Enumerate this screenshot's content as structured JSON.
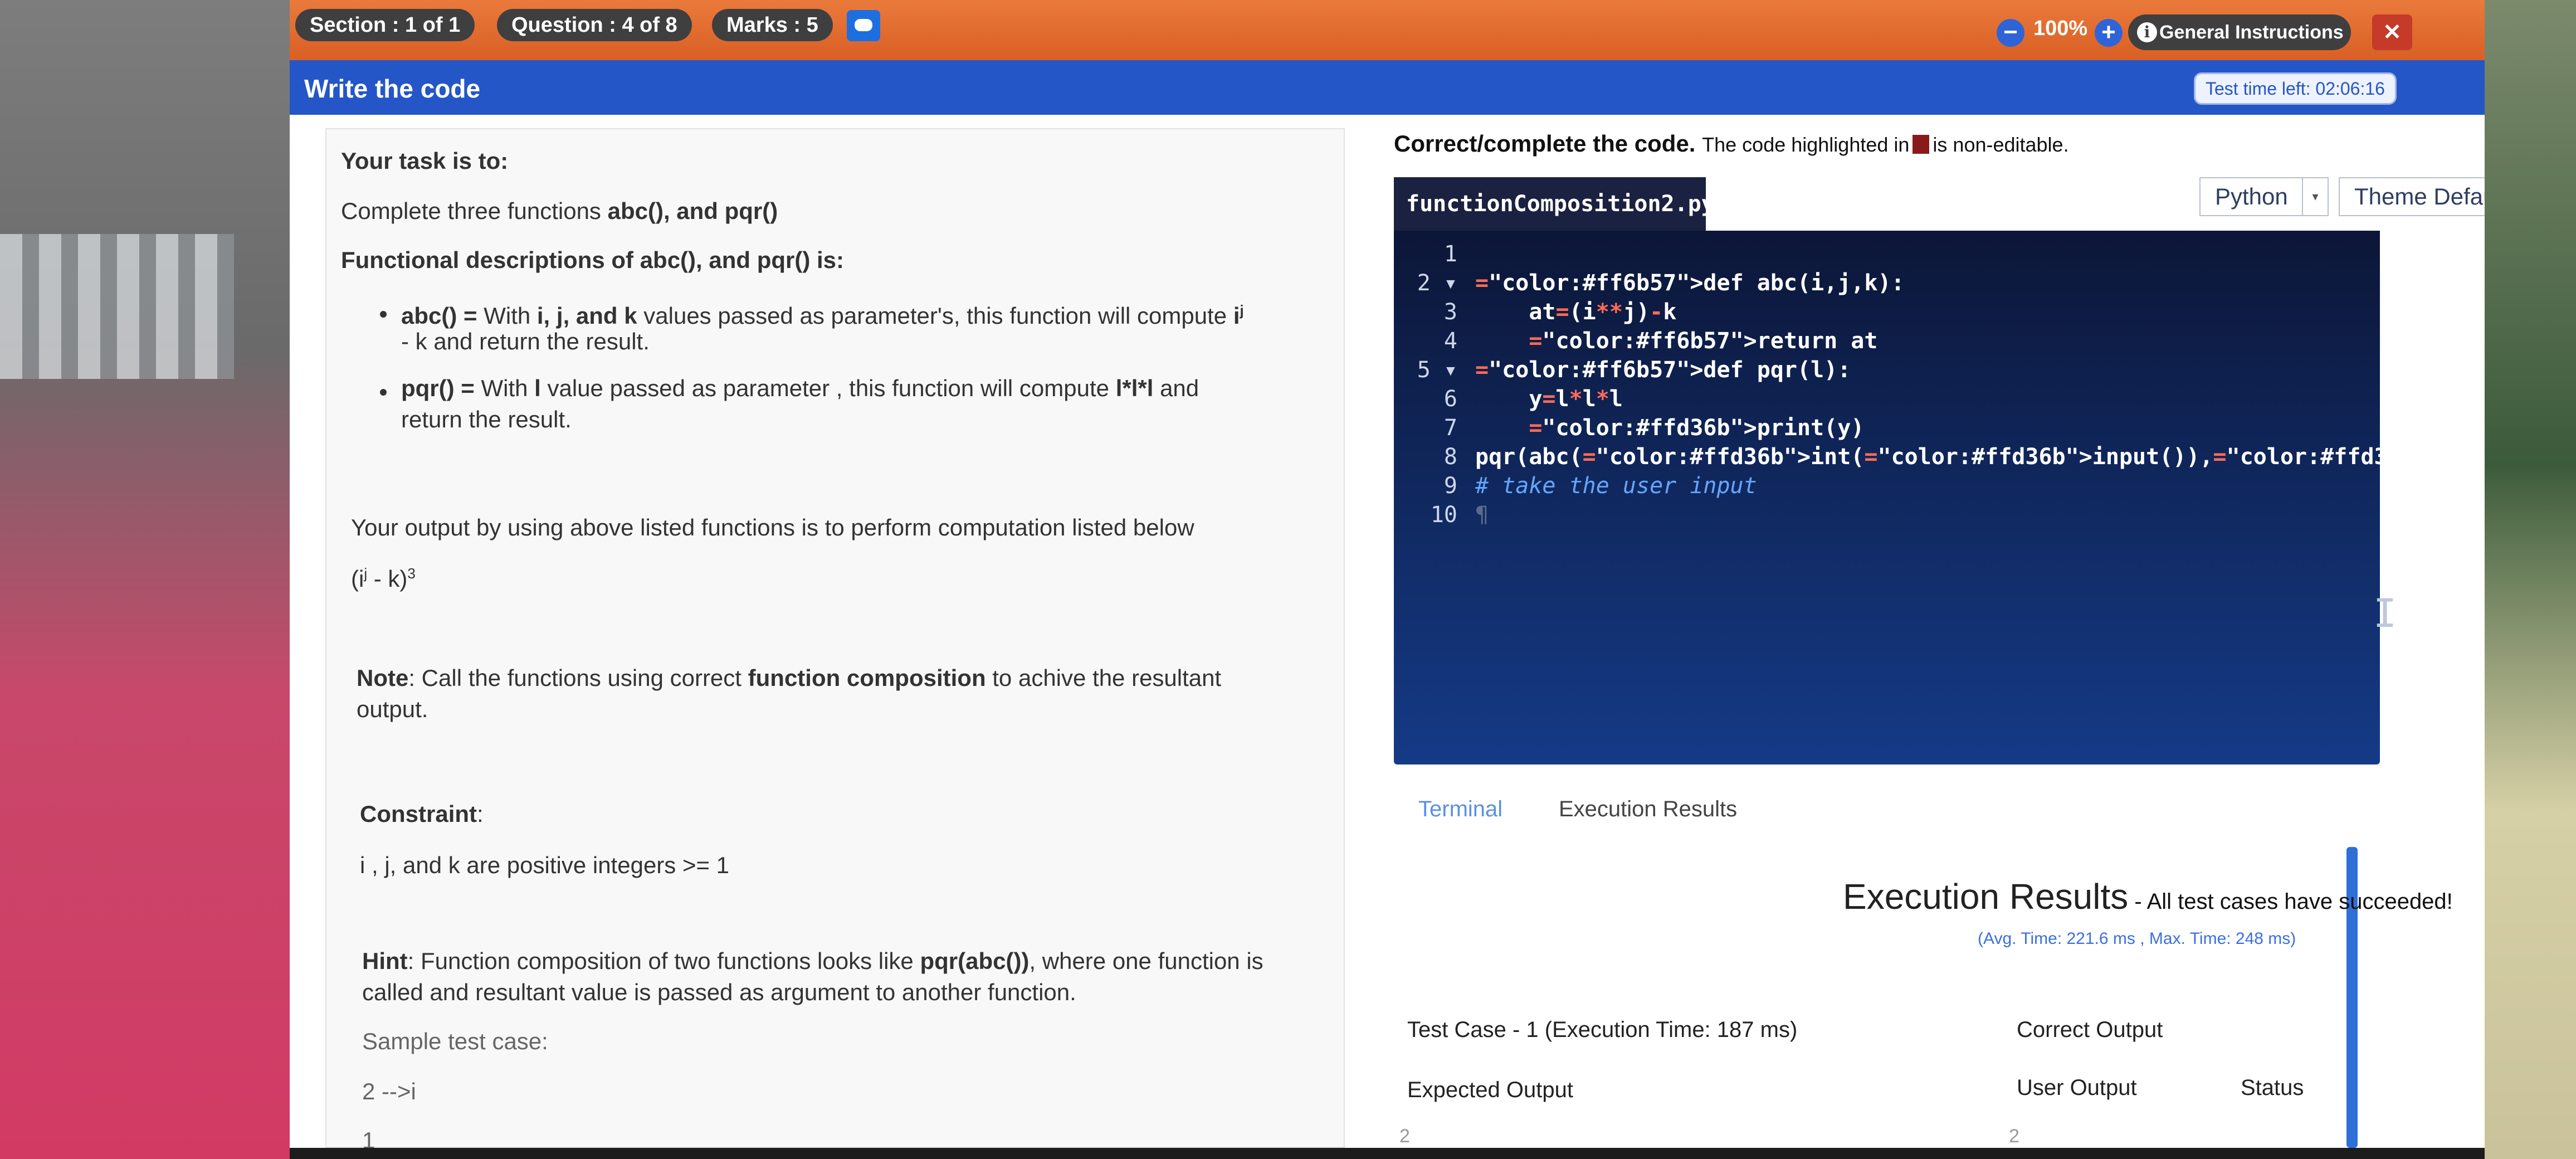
{
  "header": {
    "section": "Section : 1 of 1",
    "question": "Question : 4 of 8",
    "marks": "Marks : 5",
    "zoom_minus": "−",
    "zoom": "100%",
    "zoom_plus": "+",
    "general_instructions": "General Instructions",
    "info_glyph": "i",
    "close": "✕"
  },
  "subheader": {
    "title": "Write the code",
    "timer": "Test time left: 02:06:16"
  },
  "task": {
    "heading": "Your task is to:",
    "intro_prefix": "Complete three functions ",
    "intro_bold": "abc(), and pqr()",
    "desc_heading": "Functional descriptions of abc(), and pqr() is:",
    "b1_name": "abc() =",
    "b1_t1": " With ",
    "b1_bold": "i, j, and k",
    "b1_t2": " values passed as parameter's, this function will compute ",
    "b1_i": "i",
    "b1_sup": "j",
    "b1_line2": "- k and return the result.",
    "b2_name": "pqr() =",
    "b2_t1": " With ",
    "b2_bold1": "l",
    "b2_t2": " value passed as parameter , this function will compute ",
    "b2_bold2": "l*l*l",
    "b2_t3": " and",
    "b2_line2": "return the result.",
    "output_text": "Your output by using above listed functions is to perform computation listed below",
    "formula_open": "(i",
    "formula_sup": "j",
    "formula_mid": " - k)",
    "formula_pow": "3",
    "note_label": "Note",
    "note_t1": ": Call the functions using correct ",
    "note_bold": "function composition",
    "note_t2": " to achive the resultant",
    "note_line2": "output.",
    "constraint_label": "Constraint",
    "constraint_label_tail": ":",
    "constraint_text": "i , j, and k are positive integers >= 1",
    "hint_label": "Hint",
    "hint_t1": ": Function composition of two functions looks like ",
    "hint_bold": "pqr(abc())",
    "hint_t2": ", where one function is",
    "hint_line2": "called and resultant value is passed as argument to another function.",
    "sample_label": "Sample test case:",
    "sample_line1": "2 -->i",
    "sample_line2": "1"
  },
  "editor": {
    "heading": "Correct/complete the code.",
    "note_before": "The code highlighted in",
    "note_after": "is non-editable.",
    "noneditable_color": "#8a1a1a",
    "file_tab": "functionComposition2.py",
    "language": "Python",
    "theme": "Theme Default",
    "theme_clear": "×",
    "dropdown_arrow": "▾",
    "cursor_glyph": "I",
    "lines": [
      {
        "n": "1",
        "mark": "",
        "text": ""
      },
      {
        "n": "2",
        "mark": "▾",
        "text": "def abc(i,j,k):"
      },
      {
        "n": "3",
        "mark": "",
        "text": "    at=(i**j)-k"
      },
      {
        "n": "4",
        "mark": "",
        "text": "    return at"
      },
      {
        "n": "5",
        "mark": "▾",
        "text": "def pqr(l):"
      },
      {
        "n": "6",
        "mark": "",
        "text": "    y=l*l*l"
      },
      {
        "n": "7",
        "mark": "",
        "text": "    print(y)"
      },
      {
        "n": "8",
        "mark": "",
        "text": "pqr(abc(int(input()),int(input()),int(input())))"
      },
      {
        "n": "9",
        "mark": "",
        "text": "# take the user input"
      },
      {
        "n": "10",
        "mark": "",
        "text": "¶"
      }
    ]
  },
  "results": {
    "tab_terminal": "Terminal",
    "tab_results": "Execution Results",
    "title": "Execution Results",
    "status": " - All test cases have succeeded!",
    "avg": "(Avg. Time: 221.6 ms , Max. Time: 248 ms)",
    "testcase": "Test Case - 1",
    "exec_time": "(Execution Time: 187 ms)",
    "correct": "Correct Output",
    "expected_label": "Expected Output",
    "user_label": "User Output",
    "status_label": "Status",
    "expected_first": "2",
    "user_first": "2"
  },
  "colors": {
    "topbar": "#e06a2f",
    "bluebar": "#2456c7",
    "editor_bg": "#0f2456",
    "keyword": "#ff6b57",
    "string_builtin": "#ffd36b",
    "comment": "#64a6ff"
  }
}
